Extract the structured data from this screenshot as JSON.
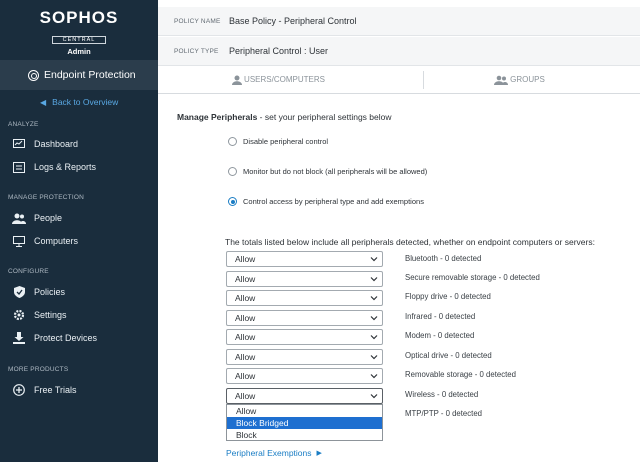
{
  "brand": {
    "name": "SOPHOS",
    "sub": "CENTRAL",
    "role": "Admin"
  },
  "product": {
    "name": "Endpoint Protection",
    "icon": "endpoint-icon"
  },
  "back_link": "Back to Overview",
  "nav": {
    "analyze": {
      "label": "ANALYZE",
      "items": [
        {
          "label": "Dashboard",
          "icon": "dashboard-icon"
        },
        {
          "label": "Logs & Reports",
          "icon": "logs-icon"
        }
      ]
    },
    "manage": {
      "label": "MANAGE PROTECTION",
      "items": [
        {
          "label": "People",
          "icon": "people-icon"
        },
        {
          "label": "Computers",
          "icon": "computer-icon"
        }
      ]
    },
    "configure": {
      "label": "CONFIGURE",
      "items": [
        {
          "label": "Policies",
          "icon": "shield-icon"
        },
        {
          "label": "Settings",
          "icon": "gear-icon"
        },
        {
          "label": "Protect Devices",
          "icon": "download-icon"
        }
      ]
    },
    "more": {
      "label": "MORE PRODUCTS",
      "items": [
        {
          "label": "Free Trials",
          "icon": "plus-circle-icon"
        }
      ]
    }
  },
  "policy": {
    "name_key": "POLICY NAME",
    "name_value": "Base Policy - Peripheral Control",
    "type_key": "POLICY TYPE",
    "type_value": "Peripheral Control : User"
  },
  "tabs": [
    {
      "label": "USERS/COMPUTERS"
    },
    {
      "label": "GROUPS"
    }
  ],
  "manage_heading": {
    "bold": "Manage Peripherals",
    "rest": " - set your peripheral settings below"
  },
  "radios": [
    {
      "label": "Disable peripheral control",
      "checked": false
    },
    {
      "label": "Monitor but do not block (all peripherals will be allowed)",
      "checked": false
    },
    {
      "label": "Control access by peripheral type and add exemptions",
      "checked": true
    }
  ],
  "totals_text": "The totals listed below include all peripherals detected, whether on endpoint computers or servers:",
  "peripherals": [
    {
      "setting": "Allow",
      "label": "Bluetooth - 0 detected"
    },
    {
      "setting": "Allow",
      "label": "Secure removable storage - 0 detected"
    },
    {
      "setting": "Allow",
      "label": "Floppy drive - 0 detected"
    },
    {
      "setting": "Allow",
      "label": "Infrared - 0 detected"
    },
    {
      "setting": "Allow",
      "label": "Modem - 0 detected"
    },
    {
      "setting": "Allow",
      "label": "Optical drive - 0 detected"
    },
    {
      "setting": "Allow",
      "label": "Removable storage - 0 detected"
    },
    {
      "setting": "Allow",
      "label": "Wireless - 0 detected"
    },
    {
      "setting": "",
      "label": "MTP/PTP - 0 detected"
    }
  ],
  "dropdown_options": [
    {
      "label": "Allow",
      "highlighted": false
    },
    {
      "label": "Block Bridged",
      "highlighted": true
    },
    {
      "label": "Block",
      "highlighted": false
    }
  ],
  "exemptions_link": "Peripheral Exemptions",
  "colors": {
    "sidebar": "#1a2d3d",
    "accent": "#1a7dc4",
    "highlight": "#1e6fd0"
  }
}
